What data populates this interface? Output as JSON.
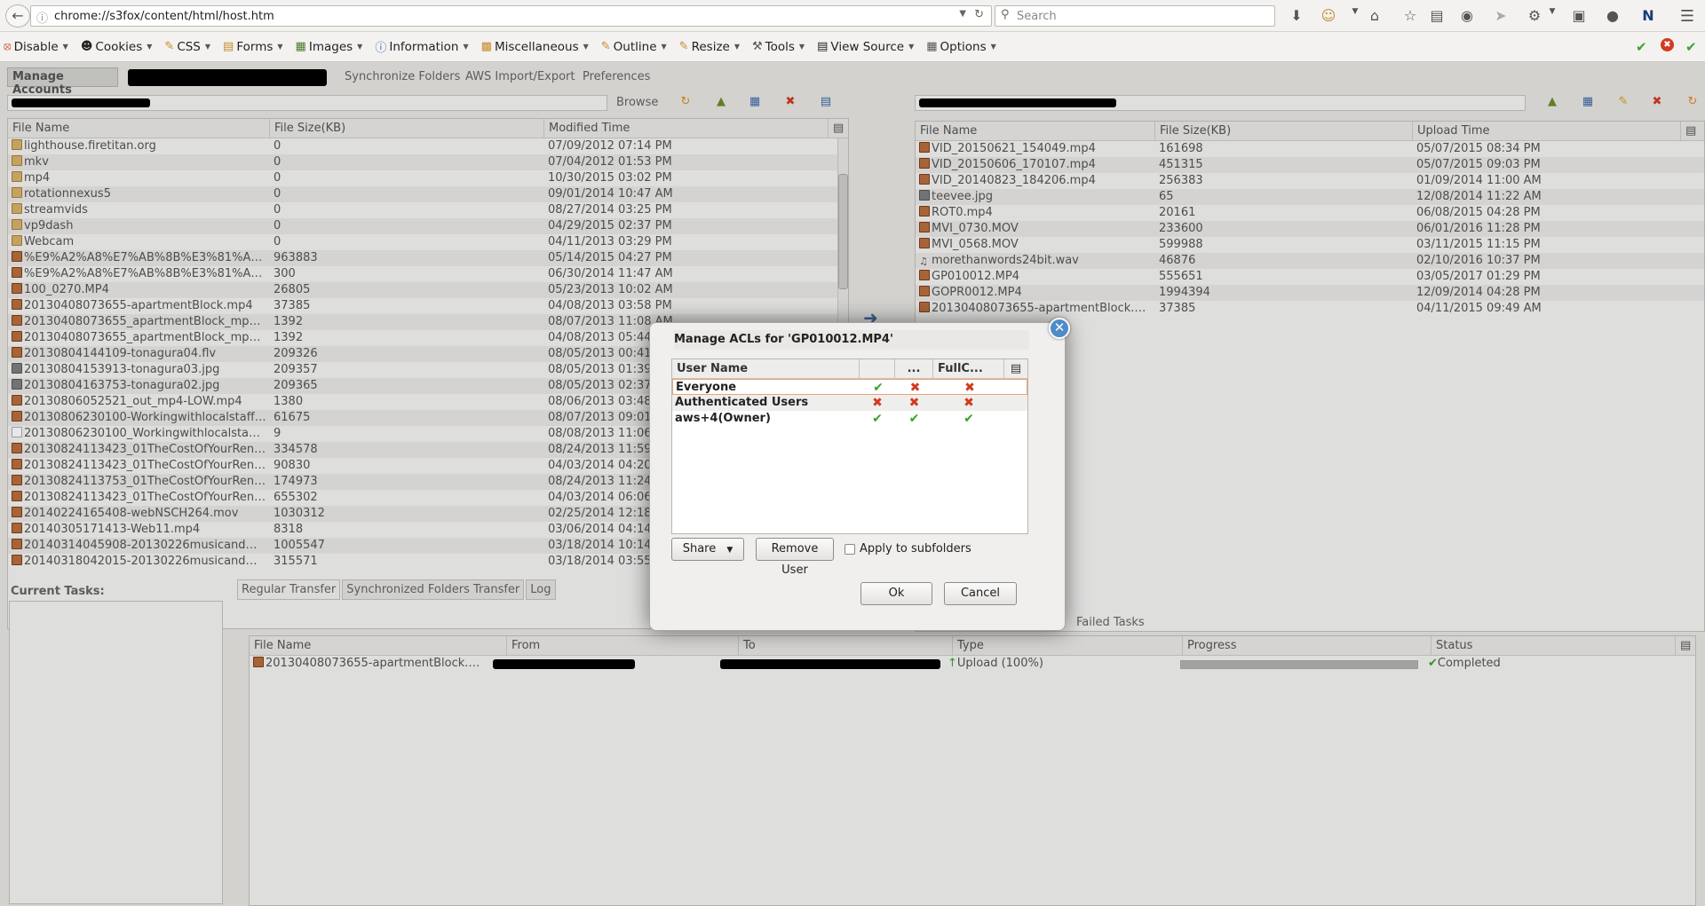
{
  "browser": {
    "url": "chrome://s3fox/content/html/host.htm",
    "search_placeholder": "Search"
  },
  "webdev_toolbar": [
    {
      "label": "Disable",
      "icon": "no-entry-icon"
    },
    {
      "label": "Cookies",
      "icon": "user-icon"
    },
    {
      "label": "CSS",
      "icon": "pencil-icon"
    },
    {
      "label": "Forms",
      "icon": "form-icon"
    },
    {
      "label": "Images",
      "icon": "image-icon"
    },
    {
      "label": "Information",
      "icon": "info-icon"
    },
    {
      "label": "Miscellaneous",
      "icon": "misc-icon"
    },
    {
      "label": "Outline",
      "icon": "pencil-icon"
    },
    {
      "label": "Resize",
      "icon": "resize-icon"
    },
    {
      "label": "Tools",
      "icon": "tools-icon"
    },
    {
      "label": "View Source",
      "icon": "view-source-icon"
    },
    {
      "label": "Options",
      "icon": "options-icon"
    }
  ],
  "app": {
    "manage_accounts": "Manage Accounts",
    "sync_folders": "Synchronize Folders",
    "aws_import": "AWS Import/Export",
    "preferences": "Preferences",
    "browse": "Browse"
  },
  "left_panel": {
    "columns": [
      "File Name",
      "File Size(KB)",
      "Modified Time"
    ],
    "rows": [
      {
        "icon": "folder",
        "name": "lighthouse.firetitan.org",
        "size": "0",
        "time": "07/09/2012 07:14 PM"
      },
      {
        "icon": "folder",
        "name": "mkv",
        "size": "0",
        "time": "07/04/2012 01:53 PM"
      },
      {
        "icon": "folder",
        "name": "mp4",
        "size": "0",
        "time": "10/30/2015 03:02 PM"
      },
      {
        "icon": "folder",
        "name": "rotationnexus5",
        "size": "0",
        "time": "09/01/2014 10:47 AM"
      },
      {
        "icon": "folder",
        "name": "streamvids",
        "size": "0",
        "time": "08/27/2014 03:25 PM"
      },
      {
        "icon": "folder",
        "name": "vp9dash",
        "size": "0",
        "time": "04/29/2015 02:37 PM"
      },
      {
        "icon": "folder",
        "name": "Webcam",
        "size": "0",
        "time": "04/11/2013 03:29 PM"
      },
      {
        "icon": "film",
        "name": "%E9%A2%A8%E7%AB%8B%E3%81%A1%...",
        "size": "963883",
        "time": "05/14/2015 04:27 PM"
      },
      {
        "icon": "film",
        "name": "%E9%A2%A8%E7%AB%8B%E3%81%A1%...",
        "size": "300",
        "time": "06/30/2014 11:47 AM"
      },
      {
        "icon": "film",
        "name": "100_0270.MP4",
        "size": "26805",
        "time": "05/23/2013 10:02 AM"
      },
      {
        "icon": "film",
        "name": "20130408073655-apartmentBlock.mp4",
        "size": "37385",
        "time": "04/08/2013 03:58 PM"
      },
      {
        "icon": "film",
        "name": "20130408073655_apartmentBlock_mp4-L...",
        "size": "1392",
        "time": "08/07/2013 11:08 AM"
      },
      {
        "icon": "film",
        "name": "20130408073655_apartmentBlock_mp4-L...",
        "size": "1392",
        "time": "04/08/2013 05:44 PM"
      },
      {
        "icon": "film",
        "name": "20130804144109-tonagura04.flv",
        "size": "209326",
        "time": "08/05/2013 00:41 AM"
      },
      {
        "icon": "img",
        "name": "20130804153913-tonagura03.jpg",
        "size": "209357",
        "time": "08/05/2013 01:39 AM"
      },
      {
        "icon": "img",
        "name": "20130804163753-tonagura02.jpg",
        "size": "209365",
        "time": "08/05/2013 02:37 AM"
      },
      {
        "icon": "film",
        "name": "20130806052521_out_mp4-LOW.mp4",
        "size": "1380",
        "time": "08/06/2013 03:48 PM"
      },
      {
        "icon": "film",
        "name": "20130806230100-Workingwithlocalstaff.AVI",
        "size": "61675",
        "time": "08/07/2013 09:01 AM"
      },
      {
        "icon": "doc",
        "name": "20130806230100_Workingwithlocalstaff_...",
        "size": "9",
        "time": "08/08/2013 11:06 AM"
      },
      {
        "icon": "film",
        "name": "20130824113423_01TheCostOfYourReno...",
        "size": "334578",
        "time": "08/24/2013 11:59 PM"
      },
      {
        "icon": "film",
        "name": "20130824113423_01TheCostOfYourReno...",
        "size": "90830",
        "time": "04/03/2014 04:20 PM"
      },
      {
        "icon": "film",
        "name": "20130824113753_01TheCostOfYourReno...",
        "size": "174973",
        "time": "08/24/2013 11:24 PM"
      },
      {
        "icon": "film",
        "name": "20130824113423_01TheCostOfYourReno...",
        "size": "655302",
        "time": "04/03/2014 06:06 PM"
      },
      {
        "icon": "film",
        "name": "20140224165408-webNSCH264.mov",
        "size": "1030312",
        "time": "02/25/2014 12:18 AM"
      },
      {
        "icon": "film",
        "name": "20140305171413-Web11.mp4",
        "size": "8318",
        "time": "03/06/2014 04:14 AM"
      },
      {
        "icon": "film",
        "name": "20140314045908-20130226musicandmo...",
        "size": "1005547",
        "time": "03/18/2014 10:14 AM"
      },
      {
        "icon": "film",
        "name": "20140318042015-20130226musicandmo...",
        "size": "315571",
        "time": "03/18/2014 03:55 PM"
      }
    ]
  },
  "right_panel": {
    "columns": [
      "File Name",
      "File Size(KB)",
      "Upload Time"
    ],
    "rows": [
      {
        "icon": "film",
        "name": "VID_20150621_154049.mp4",
        "size": "161698",
        "time": "05/07/2015 08:34 PM"
      },
      {
        "icon": "film",
        "name": "VID_20150606_170107.mp4",
        "size": "451315",
        "time": "05/07/2015 09:03 PM"
      },
      {
        "icon": "film",
        "name": "VID_20140823_184206.mp4",
        "size": "256383",
        "time": "01/09/2014 11:00 AM"
      },
      {
        "icon": "img",
        "name": "teevee.jpg",
        "size": "65",
        "time": "12/08/2014 11:22 AM"
      },
      {
        "icon": "film",
        "name": "ROT0.mp4",
        "size": "20161",
        "time": "06/08/2015 04:28 PM"
      },
      {
        "icon": "film",
        "name": "MVI_0730.MOV",
        "size": "233600",
        "time": "06/01/2016 11:28 PM"
      },
      {
        "icon": "film",
        "name": "MVI_0568.MOV",
        "size": "599988",
        "time": "03/11/2015 11:15 PM"
      },
      {
        "icon": "music",
        "name": "morethanwords24bit.wav",
        "size": "46876",
        "time": "02/10/2016 10:37 PM"
      },
      {
        "icon": "film",
        "name": "GP010012.MP4",
        "size": "555651",
        "time": "03/05/2017 01:29 PM"
      },
      {
        "icon": "film",
        "name": "GOPR0012.MP4",
        "size": "1994394",
        "time": "12/09/2014 04:28 PM"
      },
      {
        "icon": "film",
        "name": "20130408073655-apartmentBlock.mp4",
        "size": "37385",
        "time": "04/11/2015 09:49 AM"
      }
    ]
  },
  "tasks": {
    "current_tasks": "Current Tasks:",
    "tabs": [
      "Regular Transfer",
      "Synchronized Folders Transfer",
      "Log"
    ],
    "failed_tasks": "Failed Tasks",
    "columns": [
      "File Name",
      "From",
      "To",
      "Type",
      "Progress",
      "Status"
    ],
    "row": {
      "name": "20130408073655-apartmentBlock.mp4",
      "type": "Upload (100%)",
      "progress": 1.0,
      "status": "Completed"
    }
  },
  "dialog": {
    "title": "Manage ACLs for 'GP010012.MP4'",
    "columns": [
      "User Name",
      "",
      "...",
      "FullC..."
    ],
    "rows": [
      {
        "user": "Everyone",
        "perms": [
          "check",
          "cross",
          "cross"
        ]
      },
      {
        "user": "Authenticated Users",
        "perms": [
          "cross",
          "cross",
          "cross"
        ]
      },
      {
        "user": "aws+4(Owner)",
        "perms": [
          "check",
          "check",
          "check"
        ]
      }
    ],
    "share": "Share",
    "remove_user": "Remove User",
    "apply_subfolders": "Apply to subfolders",
    "ok": "Ok",
    "cancel": "Cancel"
  },
  "colors": {
    "check": "#3aa32b",
    "cross": "#d23b21",
    "accent": "#4f8bc9"
  }
}
